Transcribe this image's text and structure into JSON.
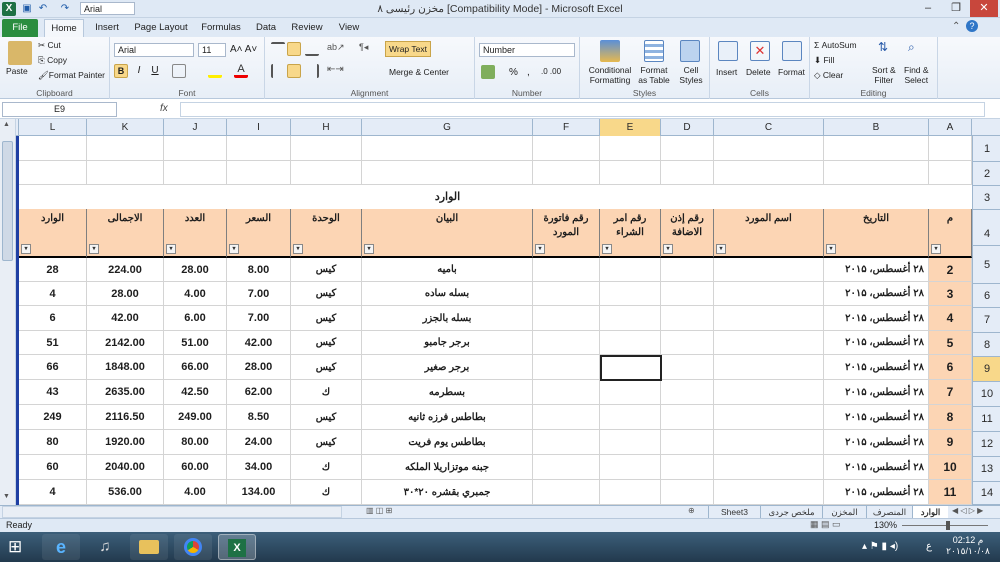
{
  "window": {
    "title": "مخزن رئيسى ٨  [Compatibility Mode]  -  Microsoft Excel",
    "font_box": "Arial"
  },
  "tabs": [
    "File",
    "Home",
    "Insert",
    "Page Layout",
    "Formulas",
    "Data",
    "Review",
    "View"
  ],
  "ribbon": {
    "clipboard": {
      "label": "Clipboard",
      "paste": "Paste",
      "cut": "Cut",
      "copy": "Copy",
      "painter": "Format Painter"
    },
    "font": {
      "label": "Font",
      "name": "Arial",
      "size": "11",
      "bold": "B",
      "italic": "I",
      "underline": "U"
    },
    "alignment": {
      "label": "Alignment",
      "wrap": "Wrap Text",
      "merge": "Merge & Center"
    },
    "number": {
      "label": "Number",
      "format": "Number",
      "pct": "%",
      "comma": ","
    },
    "styles": {
      "label": "Styles",
      "cond": "Conditional",
      "cond2": "Formatting",
      "fmt_table": "Format",
      "fmt_table2": "as Table",
      "cell_styles": "Cell",
      "cell_styles2": "Styles"
    },
    "cells": {
      "label": "Cells",
      "insert": "Insert",
      "delete": "Delete",
      "format": "Format"
    },
    "editing": {
      "label": "Editing",
      "autosum": "AutoSum",
      "fill": "Fill",
      "clear": "Clear",
      "sort": "Sort &",
      "sort2": "Filter",
      "find": "Find &",
      "find2": "Select"
    }
  },
  "namebox": "E9",
  "fx": "fx",
  "columns": [
    "L",
    "K",
    "J",
    "I",
    "H",
    "G",
    "F",
    "E",
    "D",
    "C",
    "B",
    "A"
  ],
  "rows": [
    "1",
    "2",
    "3",
    "4",
    "5",
    "6",
    "7",
    "8",
    "9",
    "10",
    "11",
    "12",
    "13",
    "14"
  ],
  "sheet": {
    "title": "الوارد",
    "headers": [
      "الوارد",
      "الاجمالى",
      "العدد",
      "السعر",
      "الوحدة",
      "البيان",
      "رقم فاتورة المورد",
      "رقم امر الشراء",
      "رقم إذن الاضافة",
      "اسم المورد",
      "التاريخ",
      "م"
    ],
    "data": [
      [
        "28",
        "224.00",
        "28.00",
        "8.00",
        "كيس",
        "باميه",
        "",
        "",
        "",
        "",
        "۲۸ أغسطس، ۲۰۱۵",
        "2"
      ],
      [
        "4",
        "28.00",
        "4.00",
        "7.00",
        "كيس",
        "بسله ساده",
        "",
        "",
        "",
        "",
        "۲۸ أغسطس، ۲۰۱۵",
        "3"
      ],
      [
        "6",
        "42.00",
        "6.00",
        "7.00",
        "كيس",
        "بسله بالجزر",
        "",
        "",
        "",
        "",
        "۲۸ أغسطس، ۲۰۱۵",
        "4"
      ],
      [
        "51",
        "2142.00",
        "51.00",
        "42.00",
        "كيس",
        "برجر جامبو",
        "",
        "",
        "",
        "",
        "۲۸ أغسطس، ۲۰۱۵",
        "5"
      ],
      [
        "66",
        "1848.00",
        "66.00",
        "28.00",
        "كيس",
        "برجر صغير",
        "",
        "",
        "",
        "",
        "۲۸ أغسطس، ۲۰۱۵",
        "6"
      ],
      [
        "43",
        "2635.00",
        "42.50",
        "62.00",
        "ك",
        "بسطرمه",
        "",
        "",
        "",
        "",
        "۲۸ أغسطس، ۲۰۱۵",
        "7"
      ],
      [
        "249",
        "2116.50",
        "249.00",
        "8.50",
        "كيس",
        "بطاطس فرزه ثانيه",
        "",
        "",
        "",
        "",
        "۲۸ أغسطس، ۲۰۱۵",
        "8"
      ],
      [
        "80",
        "1920.00",
        "80.00",
        "24.00",
        "كيس",
        "بطاطس يوم فريت",
        "",
        "",
        "",
        "",
        "۲۸ أغسطس، ۲۰۱۵",
        "9"
      ],
      [
        "60",
        "2040.00",
        "60.00",
        "34.00",
        "ك",
        "جبنه موتزاريلا الملكه",
        "",
        "",
        "",
        "",
        "۲۸ أغسطس، ۲۰۱۵",
        "10"
      ],
      [
        "4",
        "536.00",
        "4.00",
        "134.00",
        "ك",
        "جمبري بقشره ٢٠*٣٠",
        "",
        "",
        "",
        "",
        "۲۸ أغسطس، ۲۰۱۵",
        "11"
      ]
    ]
  },
  "sheet_tabs": [
    "الوارد",
    "المنصرف",
    "المخزن",
    "ملخص جردى",
    "Sheet3"
  ],
  "status": {
    "ready": "Ready",
    "zoom": "130%"
  },
  "taskbar": {
    "time": "02:12 م",
    "date": "٢٠١٥/١٠/٠٨",
    "lang": "ع"
  },
  "colors": {
    "header_fill": "#fcd5b4",
    "selected_header": "#f8d88a",
    "excel_green": "#2a8d3f"
  }
}
